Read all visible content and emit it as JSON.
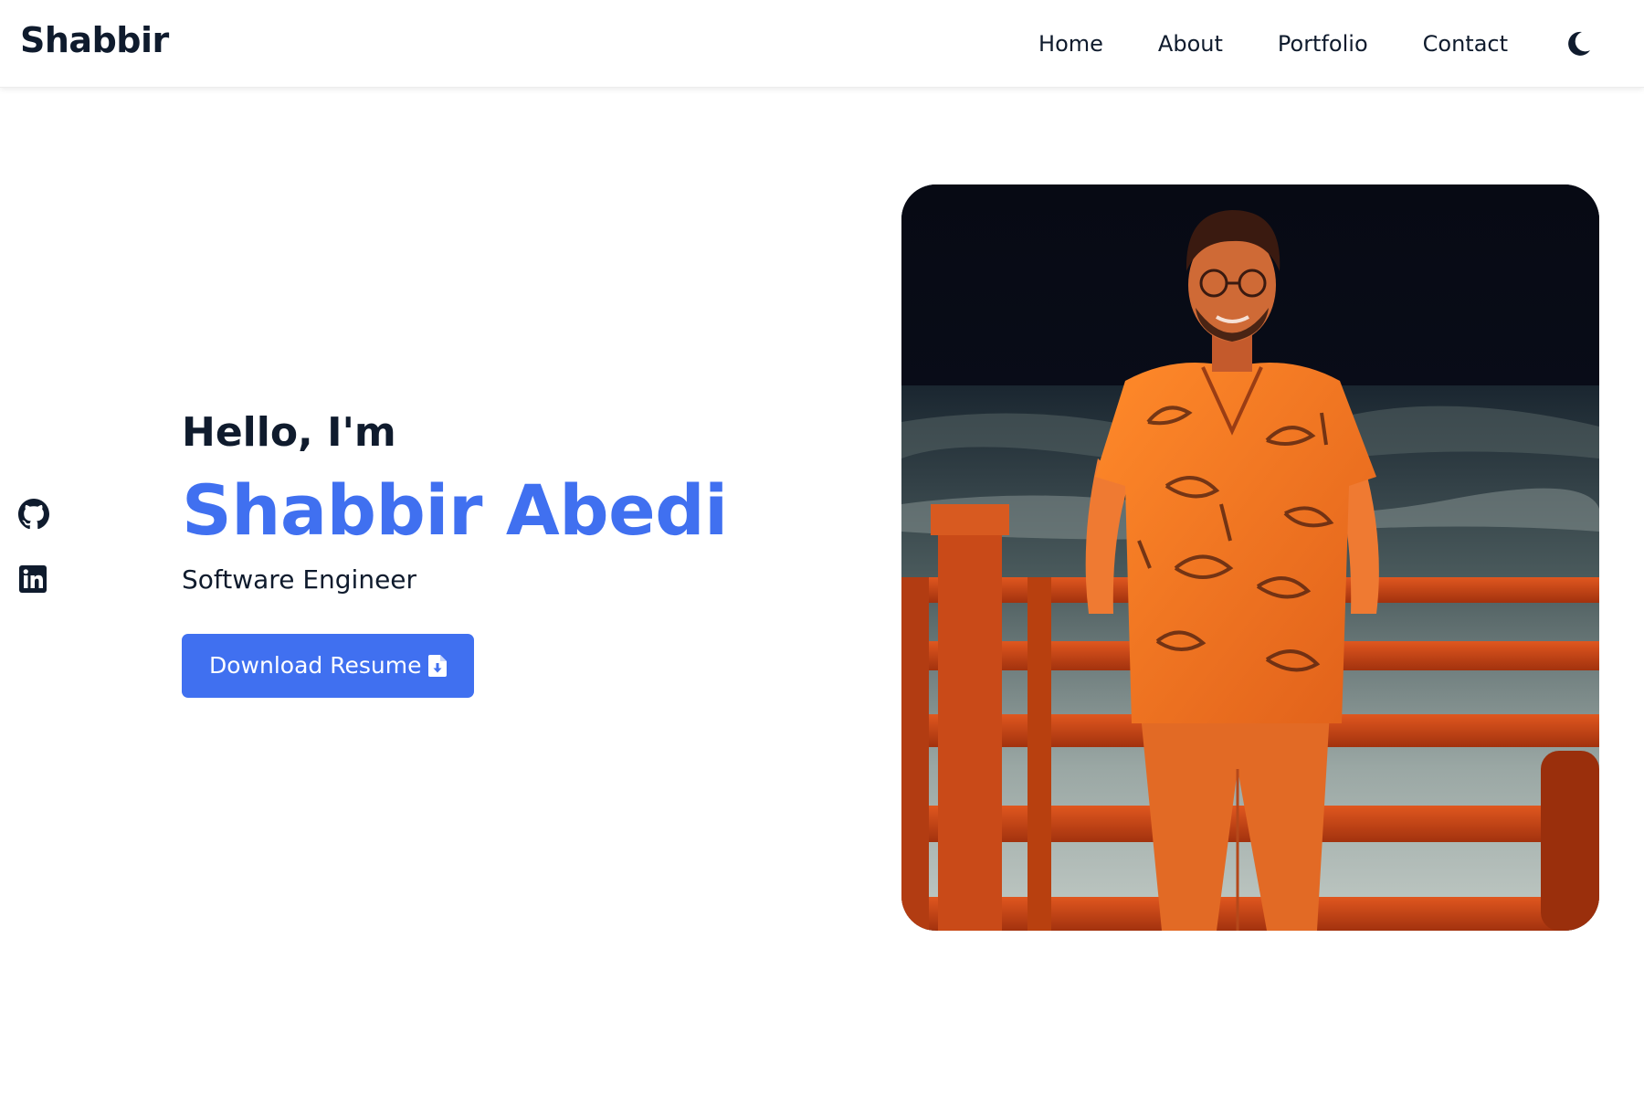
{
  "header": {
    "logo": "Shabbir",
    "nav": [
      "Home",
      "About",
      "Portfolio",
      "Contact"
    ],
    "theme_toggle_icon": "moon-icon"
  },
  "social": {
    "icons": [
      "github-icon",
      "linkedin-icon"
    ]
  },
  "hero": {
    "greeting": "Hello, I'm",
    "name": "Shabbir Abedi",
    "role": "Software Engineer",
    "button_label": "Download Resume",
    "button_icon": "file-download-icon"
  },
  "photo": {
    "description_icon": "profile-photo"
  },
  "colors": {
    "accent": "#4070f0",
    "text": "#0f1b2d",
    "background": "#ffffff"
  }
}
